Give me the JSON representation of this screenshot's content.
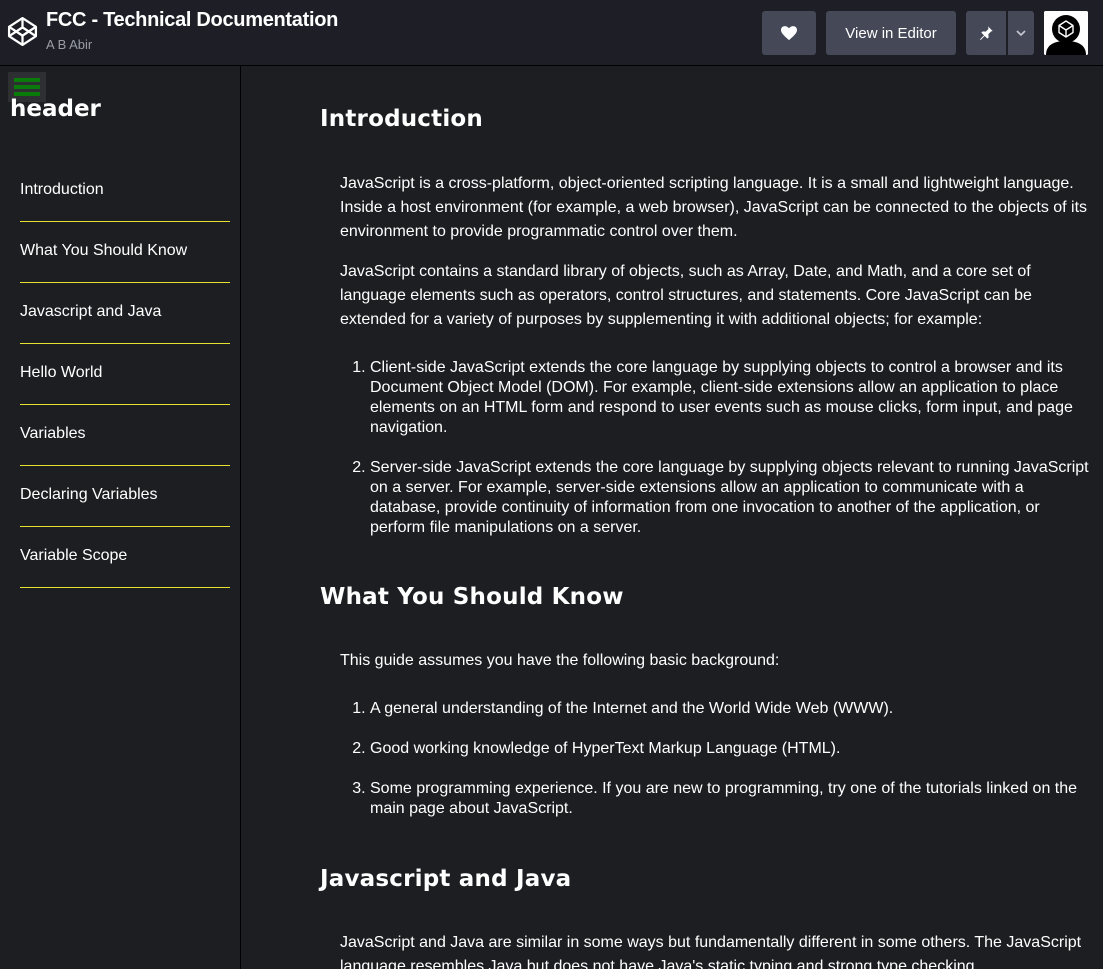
{
  "topbar": {
    "title": "FCC - Technical Documentation",
    "author": "A B Abir",
    "view_in_editor": "View in Editor",
    "heart_icon": "heart-icon",
    "pin_icon": "pin-icon",
    "chevron_icon": "chevron-down-icon",
    "logo_icon": "codepen-logo-icon"
  },
  "sidebar": {
    "header": "header",
    "items": [
      {
        "label": "Introduction"
      },
      {
        "label": "What You Should Know"
      },
      {
        "label": "Javascript and Java"
      },
      {
        "label": "Hello World"
      },
      {
        "label": "Variables"
      },
      {
        "label": "Declaring Variables"
      },
      {
        "label": "Variable Scope"
      }
    ],
    "accent_color": "#e8e030"
  },
  "main": {
    "sections": [
      {
        "heading": "Introduction",
        "paragraphs": [
          "JavaScript is a cross-platform, object-oriented scripting language. It is a small and lightweight language. Inside a host environment (for example, a web browser), JavaScript can be connected to the objects of its environment to provide programmatic control over them.",
          "JavaScript contains a standard library of objects, such as Array, Date, and Math, and a core set of language elements such as operators, control structures, and statements. Core JavaScript can be extended for a variety of purposes by supplementing it with additional objects; for example:"
        ],
        "list": [
          "Client-side JavaScript extends the core language by supplying objects to control a browser and its Document Object Model (DOM). For example, client-side extensions allow an application to place elements on an HTML form and respond to user events such as mouse clicks, form input, and page navigation.",
          "Server-side JavaScript extends the core language by supplying objects relevant to running JavaScript on a server. For example, server-side extensions allow an application to communicate with a database, provide continuity of information from one invocation to another of the application, or perform file manipulations on a server."
        ]
      },
      {
        "heading": "What You Should Know",
        "paragraphs": [
          "This guide assumes you have the following basic background:"
        ],
        "list": [
          "A general understanding of the Internet and the World Wide Web (WWW).",
          "Good working knowledge of HyperText Markup Language (HTML).",
          "Some programming experience. If you are new to programming, try one of the tutorials linked on the main page about JavaScript."
        ]
      },
      {
        "heading": "Javascript and Java",
        "paragraphs": [
          "JavaScript and Java are similar in some ways but fundamentally different in some others. The JavaScript language resembles Java but does not have Java's static typing and strong type checking."
        ]
      }
    ]
  }
}
